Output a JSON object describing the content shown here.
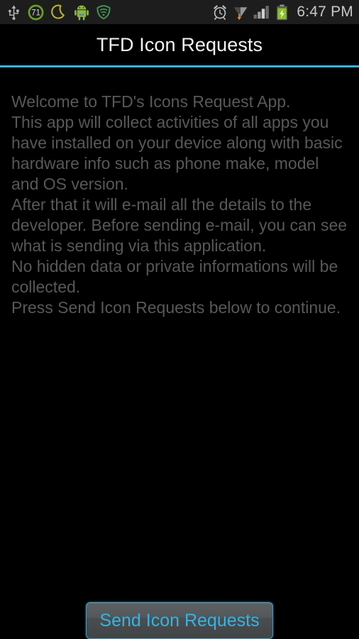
{
  "statusbar": {
    "left_icons": [
      {
        "name": "usb-icon",
        "label": "USB connected"
      },
      {
        "name": "battery-percent-circle-icon",
        "label": "71",
        "value": "71",
        "color": "#6aa320"
      },
      {
        "name": "moon-night-mode-icon",
        "label": "Night mode",
        "color": "#b8b32c"
      },
      {
        "name": "android-system-icon",
        "label": "Android system",
        "color": "#8ab63f"
      },
      {
        "name": "shield-security-icon",
        "label": "Security",
        "color": "#3f9a52"
      }
    ],
    "right_icons": [
      {
        "name": "alarm-clock-icon",
        "label": "Alarm set",
        "color": "#bdbdbd"
      },
      {
        "name": "wifi-download-icon",
        "label": "Wi-Fi downloading",
        "color": "#bdbdbd"
      },
      {
        "name": "cellular-signal-icon",
        "label": "Signal strength",
        "color": "#bdbdbd"
      },
      {
        "name": "battery-charging-icon",
        "label": "Battery charging",
        "color": "#8ac11f"
      }
    ],
    "clock": "6:47 PM"
  },
  "actionbar": {
    "title": "TFD Icon Requests",
    "accent_color": "#33b5e5"
  },
  "content": {
    "paragraphs": [
      "Welcome to TFD's Icons Request App.",
      "This app will collect activities of all apps you have installed on your device along with basic hardware info such as phone make, model and OS version.\nAfter that it will e-mail all the details to the developer. Before sending e-mail, you can see what is sending via this application.\nNo hidden data or private informations will be collected.",
      "Press Send Icon Requests below to continue."
    ],
    "text_color": "#585858"
  },
  "footer": {
    "send_button_label": "Send Icon Requests",
    "send_button_text_color": "#33b5e5"
  }
}
